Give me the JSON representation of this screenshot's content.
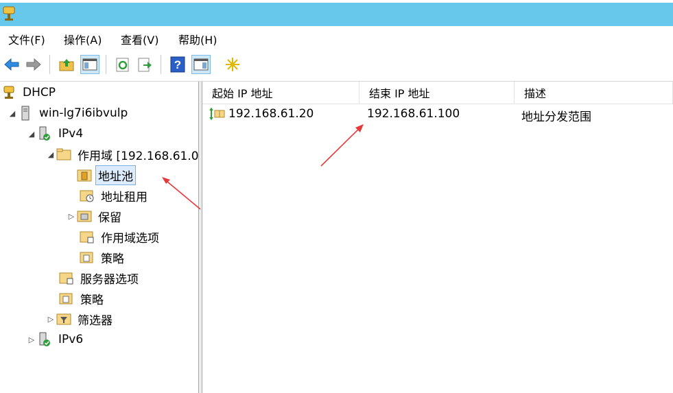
{
  "menu": [
    "文件(F)",
    "操作(A)",
    "查看(V)",
    "帮助(H)"
  ],
  "toolbar": {
    "buttons": [
      "back-icon",
      "forward-icon",
      "up-folder-icon",
      "show-tree-icon",
      "refresh-icon",
      "export-list-icon",
      "help-icon",
      "show-action-pane-icon",
      "star-icon"
    ]
  },
  "tree": {
    "root": "DHCP",
    "server": "win-lg7i6ibvulp",
    "ipv4": "IPv4",
    "scope": "作用域 [192.168.61.0",
    "pool": "地址池",
    "leases": "地址租用",
    "reservations": "保留",
    "scope_options": "作用域选项",
    "scope_policies": "策略",
    "server_options": "服务器选项",
    "policies": "策略",
    "filters": "筛选器",
    "ipv6": "IPv6"
  },
  "list": {
    "columns": [
      "起始 IP 地址",
      "结束 IP 地址",
      "描述"
    ],
    "rows": [
      {
        "start": "192.168.61.20",
        "end": "192.168.61.100",
        "desc": "地址分发范围"
      }
    ]
  },
  "colors": {
    "titlebar": "#67c8eb",
    "selection": "#dcecfc",
    "annotation_arrow": "#e8393a"
  }
}
